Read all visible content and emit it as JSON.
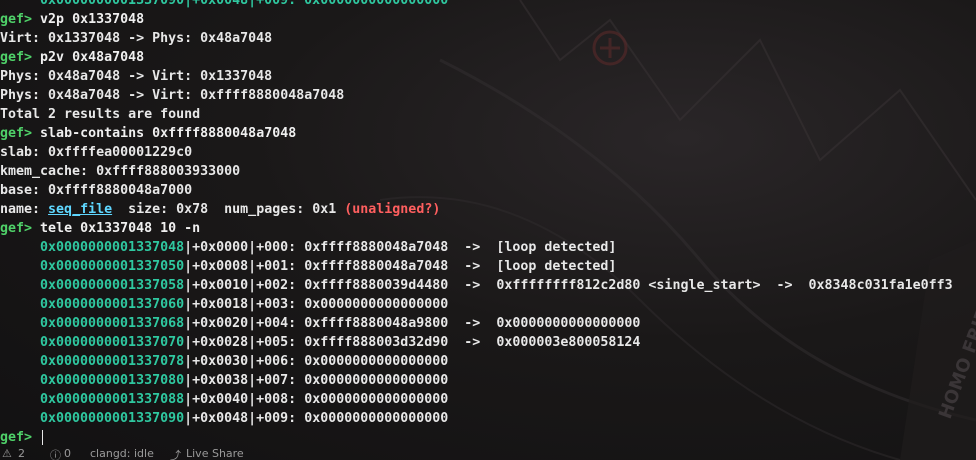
{
  "prompt": "gef>",
  "lines": [
    {
      "type": "tele_partial",
      "text": "0x0000000001337090|+0x0048|+009: 0x0000000000000000"
    },
    {
      "type": "cmd",
      "cmd": "v2p 0x1337048"
    },
    {
      "type": "out",
      "text": "Virt: 0x1337048 -> Phys: 0x48a7048"
    },
    {
      "type": "cmd",
      "cmd": "p2v 0x48a7048"
    },
    {
      "type": "out",
      "text": "Phys: 0x48a7048 -> Virt: 0x1337048"
    },
    {
      "type": "out",
      "text": "Phys: 0x48a7048 -> Virt: 0xffff8880048a7048"
    },
    {
      "type": "out",
      "text": "Total 2 results are found"
    },
    {
      "type": "cmd",
      "cmd": "slab-contains 0xffff8880048a7048"
    },
    {
      "type": "out",
      "text": "slab: 0xffffea00001229c0"
    },
    {
      "type": "out",
      "text": "kmem_cache: 0xffff888003933000"
    },
    {
      "type": "out",
      "text": "base: 0xffff8880048a7000"
    }
  ],
  "name_line": {
    "prefix": "name: ",
    "name": "seq_file",
    "mid": "  size: 0x78  num_pages: 0x1 ",
    "warn": "(unaligned?)"
  },
  "tele_cmd": "tele 0x1337048 10 -n",
  "tele": [
    {
      "addr": "0x0000000001337048",
      "rest": "|+0x0000|+000: 0xffff8880048a7048  ->  [loop detected]"
    },
    {
      "addr": "0x0000000001337050",
      "rest": "|+0x0008|+001: 0xffff8880048a7048  ->  [loop detected]"
    },
    {
      "addr": "0x0000000001337058",
      "rest": "|+0x0010|+002: 0xffff8880039d4480  ->  0xffffffff812c2d80 <single_start>  ->  0x8348c031fa1e0ff3"
    },
    {
      "addr": "0x0000000001337060",
      "rest": "|+0x0018|+003: 0x0000000000000000"
    },
    {
      "addr": "0x0000000001337068",
      "rest": "|+0x0020|+004: 0xffff8880048a9800  ->  0x0000000000000000"
    },
    {
      "addr": "0x0000000001337070",
      "rest": "|+0x0028|+005: 0xffff888003d32d90  ->  0x000003e800058124"
    },
    {
      "addr": "0x0000000001337078",
      "rest": "|+0x0030|+006: 0x0000000000000000"
    },
    {
      "addr": "0x0000000001337080",
      "rest": "|+0x0038|+007: 0x0000000000000000"
    },
    {
      "addr": "0x0000000001337088",
      "rest": "|+0x0040|+008: 0x0000000000000000"
    },
    {
      "addr": "0x0000000001337090",
      "rest": "|+0x0048|+009: 0x0000000000000000"
    }
  ],
  "status": {
    "warnings": "2",
    "info": "0",
    "lsp": "clangd: idle",
    "share": "Live Share"
  }
}
